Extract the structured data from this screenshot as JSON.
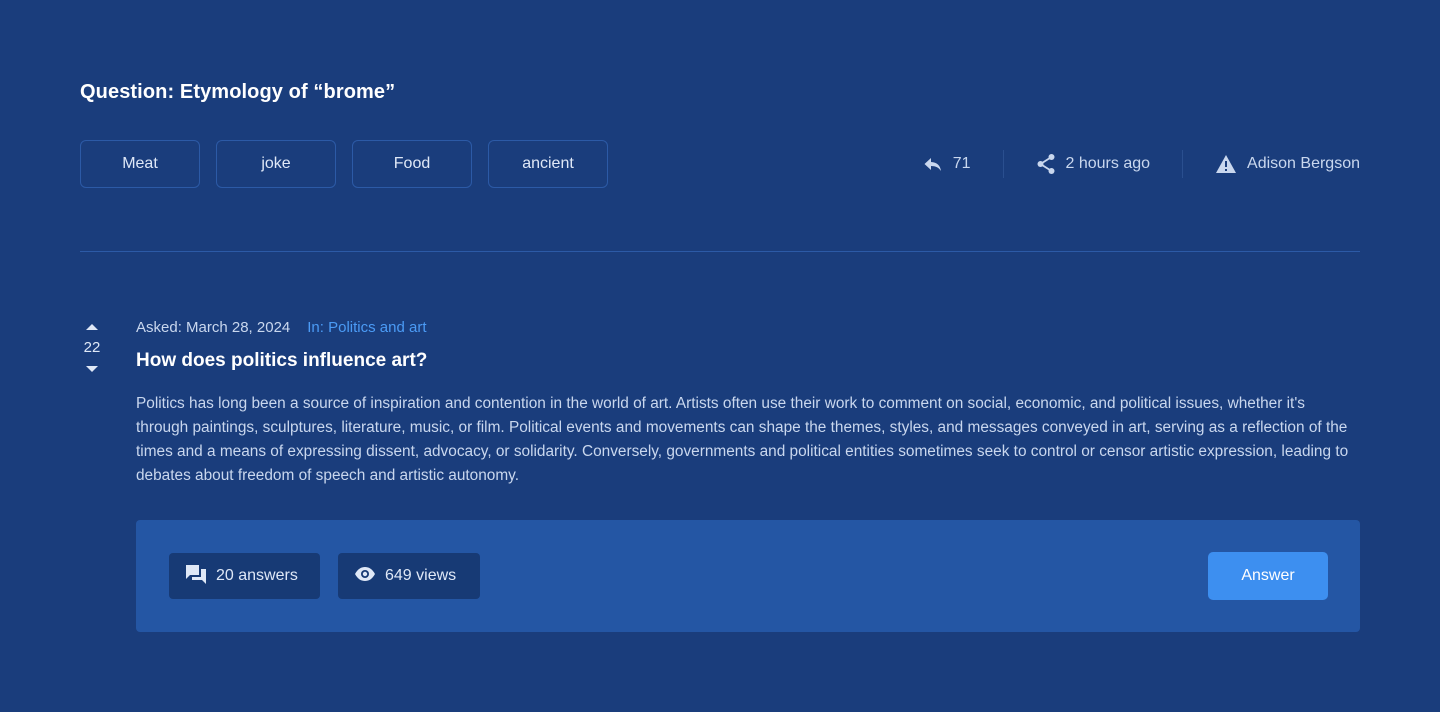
{
  "question": {
    "title": "Question: Etymology of “brome”",
    "tags": [
      "Meat",
      "joke",
      "Food",
      "ancient"
    ],
    "meta": {
      "reply_icon": "reply-icon",
      "replies": "71",
      "share_icon": "share-icon",
      "time": "2 hours ago",
      "warning_icon": "warning-icon",
      "author": "Adison Bergson"
    }
  },
  "post": {
    "votes": "22",
    "asked": "Asked: March 28, 2024",
    "category": "In: Politics and art",
    "title": "How does politics influence art?",
    "body": "Politics has long been a source of inspiration and contention in the world of art. Artists often use their work to comment on social, economic, and political issues, whether it's through paintings, sculptures, literature, music, or film. Political events and movements can shape the themes, styles, and messages conveyed in art, serving as a reflection of the times and a means of expressing dissent, advocacy, or solidarity. Conversely, governments and political entities sometimes seek to control or censor artistic expression, leading to debates about freedom of speech and artistic autonomy.",
    "stats": {
      "answers_icon": "chat-bubbles-icon",
      "answers": "20 answers",
      "views_icon": "eye-icon",
      "views": "649 views"
    },
    "answer_button": "Answer"
  },
  "colors": {
    "background": "#1a3d7c",
    "panel": "#2456a4",
    "accent": "#3d8ff0",
    "link": "#4b9bf5"
  }
}
